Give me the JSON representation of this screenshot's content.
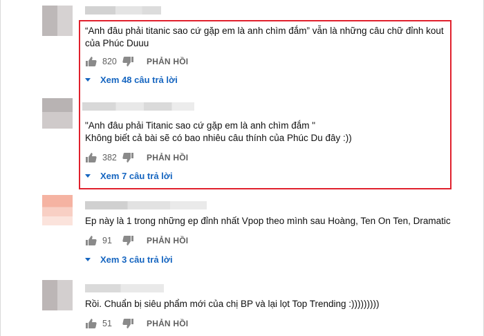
{
  "colors": {
    "link": "#1565c0",
    "highlight": "#e0202c",
    "muted": "#606060"
  },
  "comments": [
    {
      "text_lines": [
        "“Anh đâu phải titanic sao cứ gặp em là anh chìm đắm” vẫn là những câu chữ đỉnh kout",
        "của Phúc Duuu"
      ],
      "likes": "820",
      "reply_label": "PHẢN HỒI",
      "view_replies": "Xem 48 câu trả lời"
    },
    {
      "text_lines": [
        "\"Anh đâu phải Titanic sao cứ gặp em là anh chìm đắm \"",
        "Không biết cả bài sẽ có bao nhiêu câu thính của Phúc Du đây :))"
      ],
      "likes": "382",
      "reply_label": "PHẢN HỒI",
      "view_replies": "Xem 7 câu trả lời"
    },
    {
      "text_lines": [
        "Ep này là 1 trong những ep đỉnh nhất Vpop theo mình sau Hoàng, Ten On Ten, Dramatic"
      ],
      "likes": "91",
      "reply_label": "PHẢN HỒI",
      "view_replies": "Xem 3 câu trả lời"
    },
    {
      "text_lines": [
        "Rồi. Chuẩn bị siêu phẩm mới của chị BP và lại lọt Top Trending :)))))))))"
      ],
      "likes": "51",
      "reply_label": "PHẢN HỒI"
    }
  ]
}
